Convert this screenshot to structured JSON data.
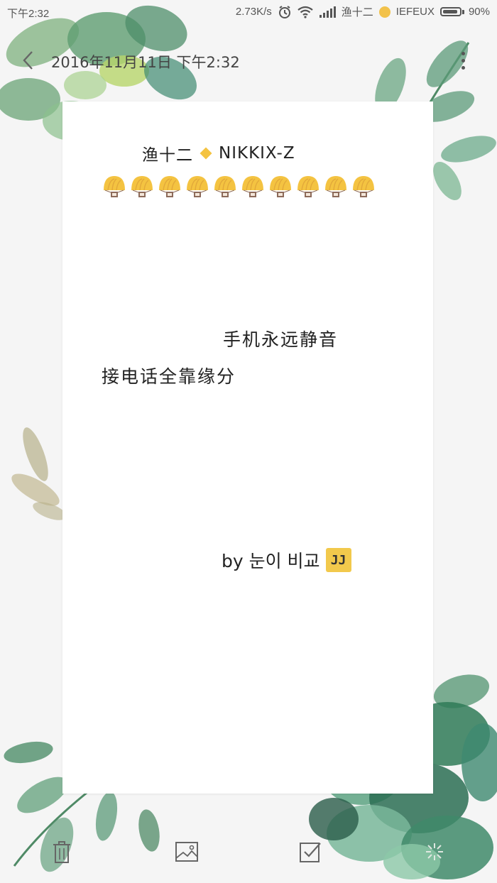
{
  "status_bar": {
    "time": "下午2:32",
    "speed": "2.73K/s",
    "carrier": "渔十二",
    "network_name": "IEFEUX",
    "battery_label": "90%",
    "battery_level": 0.9
  },
  "header": {
    "date": "2016年11月11日  下午2:32"
  },
  "note": {
    "title_left": "渔十二",
    "title_right": "NIKKIX-Z",
    "emoji_count": 10,
    "line_1": "手机永远静音",
    "line_2": "接电话全靠缘分",
    "signature": "by 눈이 비교",
    "signature_badge": "JJ"
  },
  "toolbar": {
    "icons": [
      "trash-icon",
      "image-icon",
      "checklist-icon",
      "more-tools-icon"
    ]
  },
  "colors": {
    "background": "#f5f5f5",
    "card": "#ffffff",
    "accent": "#f4c341",
    "leaf_dark": "#2f7a57",
    "leaf_light": "#8cc08d"
  }
}
